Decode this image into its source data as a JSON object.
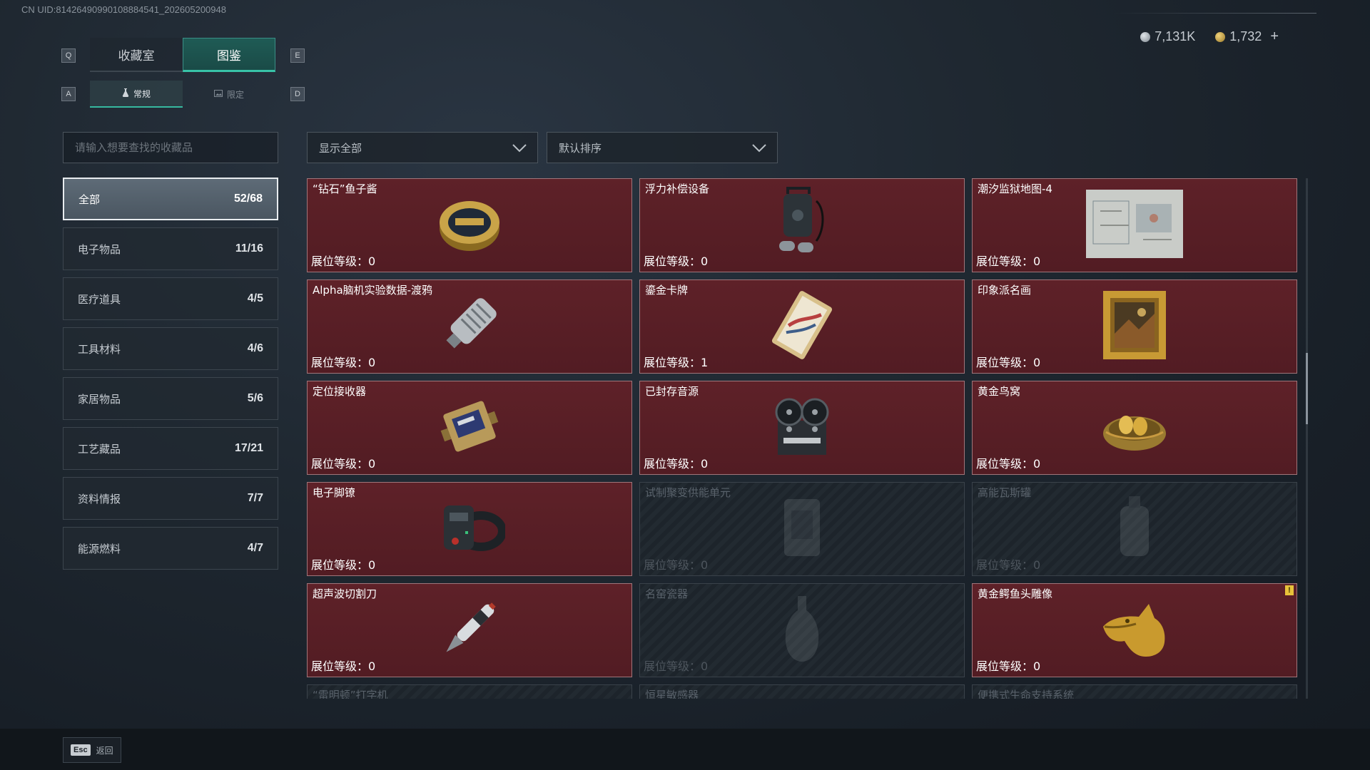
{
  "uid": "CN UID:81426490990108884541_202605200948",
  "key_hints": {
    "q": "Q",
    "e": "E",
    "a": "A",
    "d": "D"
  },
  "tabs": [
    {
      "label": "收藏室",
      "active": false
    },
    {
      "label": "图鉴",
      "active": true
    }
  ],
  "subtabs": [
    {
      "label": "常规",
      "active": true
    },
    {
      "label": "限定",
      "active": false
    }
  ],
  "currency": [
    {
      "value": "7,131K",
      "color": "#9aa3ab"
    },
    {
      "value": "1,732",
      "color": "#c9a84e"
    }
  ],
  "currency_add": "+",
  "search": {
    "placeholder": "请输入想要查找的收藏品"
  },
  "filter_dropdown": "显示全部",
  "sort_dropdown": "默认排序",
  "categories": [
    {
      "label": "全部",
      "count": "52/68",
      "active": true
    },
    {
      "label": "电子物品",
      "count": "11/16"
    },
    {
      "label": "医疗道具",
      "count": "4/5"
    },
    {
      "label": "工具材料",
      "count": "4/6"
    },
    {
      "label": "家居物品",
      "count": "5/6"
    },
    {
      "label": "工艺藏品",
      "count": "17/21"
    },
    {
      "label": "资料情报",
      "count": "7/7"
    },
    {
      "label": "能源燃料",
      "count": "4/7"
    }
  ],
  "level_prefix": "展位等级：",
  "items": [
    {
      "name": "“钻石”鱼子酱",
      "level": "0",
      "locked": false,
      "icon": "caviar-tin-icon"
    },
    {
      "name": "浮力补偿设备",
      "level": "0",
      "locked": false,
      "icon": "buoyancy-device-icon"
    },
    {
      "name": "潮汐监狱地图-4",
      "level": "0",
      "locked": false,
      "icon": "map-icon"
    },
    {
      "name": "Alpha脑机实验数据-渡鸦",
      "level": "0",
      "locked": false,
      "icon": "data-drive-icon"
    },
    {
      "name": "鎏金卡牌",
      "level": "1",
      "locked": false,
      "icon": "gilded-card-icon"
    },
    {
      "name": "印象派名画",
      "level": "0",
      "locked": false,
      "icon": "painting-icon"
    },
    {
      "name": "定位接收器",
      "level": "0",
      "locked": false,
      "icon": "receiver-icon"
    },
    {
      "name": "已封存音源",
      "level": "0",
      "locked": false,
      "icon": "reel-recorder-icon"
    },
    {
      "name": "黄金鸟窝",
      "level": "0",
      "locked": false,
      "icon": "golden-nest-icon"
    },
    {
      "name": "电子脚镣",
      "level": "0",
      "locked": false,
      "icon": "ankle-monitor-icon"
    },
    {
      "name": "试制聚变供能单元",
      "level": "0",
      "locked": true,
      "icon": "fusion-cell-icon"
    },
    {
      "name": "高能瓦斯罐",
      "level": "0",
      "locked": true,
      "icon": "gas-canister-icon"
    },
    {
      "name": "超声波切割刀",
      "level": "0",
      "locked": false,
      "icon": "ultrasonic-cutter-icon"
    },
    {
      "name": "名窑瓷器",
      "level": "0",
      "locked": true,
      "icon": "porcelain-vase-icon"
    },
    {
      "name": "黄金鳄鱼头雕像",
      "level": "0",
      "locked": false,
      "icon": "golden-croc-statue-icon",
      "alert": "!"
    },
    {
      "name": "“雷明顿”打字机",
      "level": "",
      "locked": true,
      "icon": ""
    },
    {
      "name": "恒星敏感器",
      "level": "",
      "locked": true,
      "icon": ""
    },
    {
      "name": "便携式生命支持系统",
      "level": "",
      "locked": true,
      "icon": ""
    }
  ],
  "footer": {
    "key": "Esc",
    "label": "返回"
  }
}
